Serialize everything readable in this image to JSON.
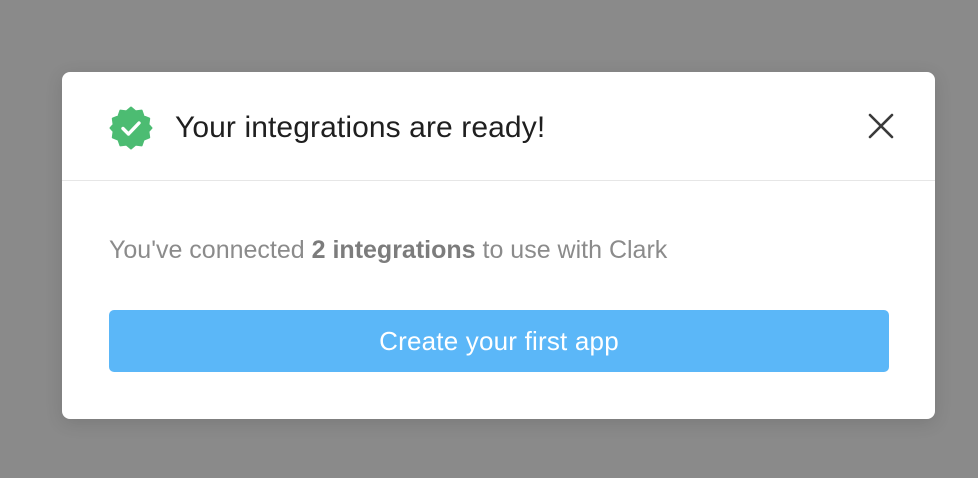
{
  "modal": {
    "title": "Your integrations are ready!",
    "icon": "verified-badge-check-icon",
    "close_icon": "close-icon",
    "body": {
      "prefix": "You've connected ",
      "highlight": "2 integrations",
      "suffix": " to use with Clark"
    },
    "primary_button_label": "Create your first app"
  },
  "colors": {
    "backdrop": "#8a8a8a",
    "badge_green": "#4cbc72",
    "button_blue": "#5bb7f8",
    "title_text": "#1f1f1f",
    "body_text": "#8b8b8b"
  }
}
